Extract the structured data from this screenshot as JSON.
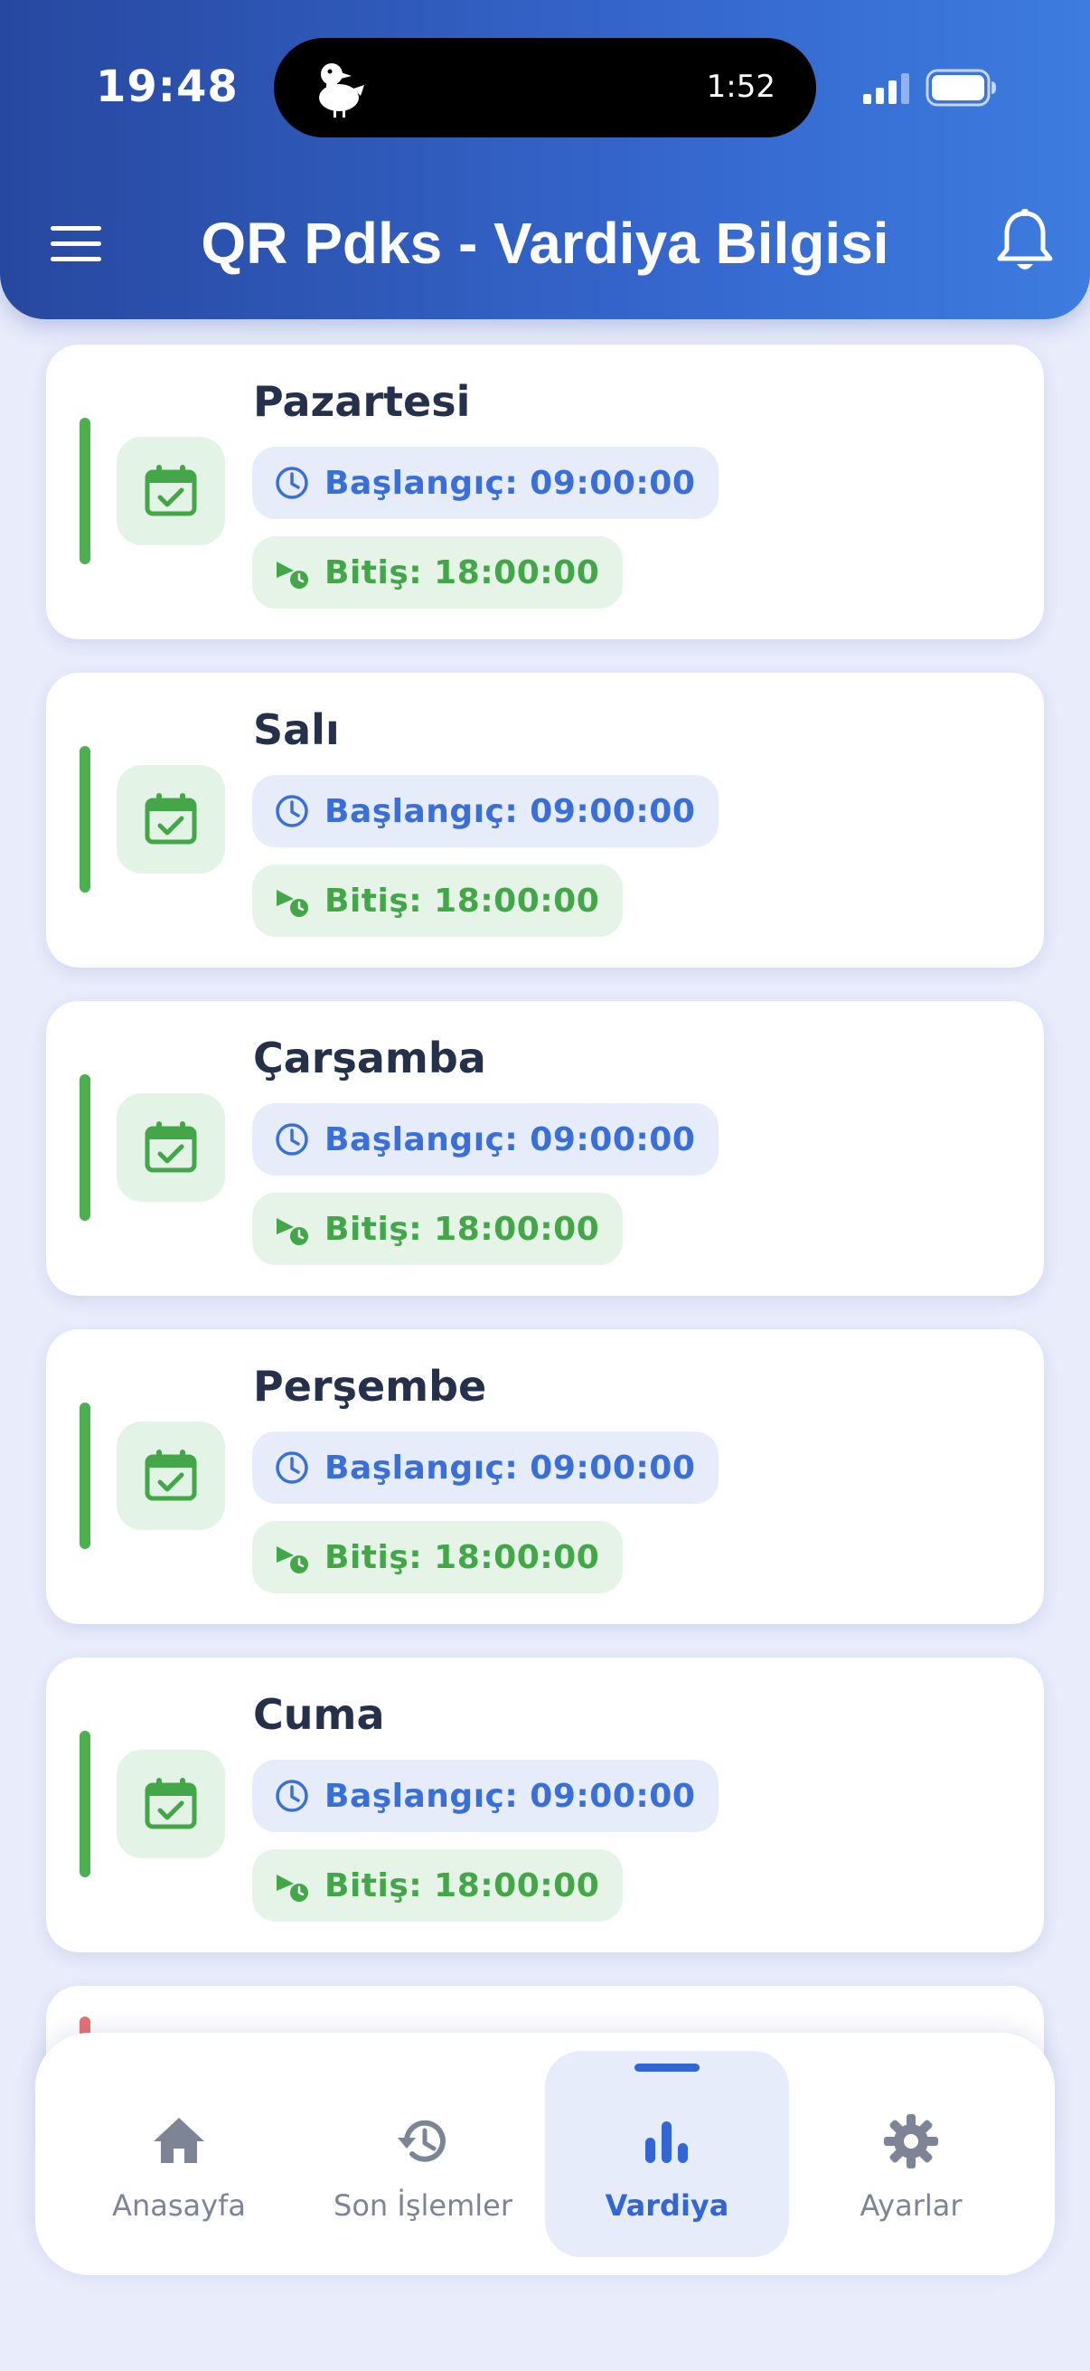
{
  "status_bar": {
    "time": "19:48",
    "island_timer": "1:52"
  },
  "header": {
    "title": "QR Pdks - Vardiya Bilgisi"
  },
  "shifts": [
    {
      "day": "Pazartesi",
      "start": "Başlangıç: 09:00:00",
      "end": "Bitiş: 18:00:00"
    },
    {
      "day": "Salı",
      "start": "Başlangıç: 09:00:00",
      "end": "Bitiş: 18:00:00"
    },
    {
      "day": "Çarşamba",
      "start": "Başlangıç: 09:00:00",
      "end": "Bitiş: 18:00:00"
    },
    {
      "day": "Perşembe",
      "start": "Başlangıç: 09:00:00",
      "end": "Bitiş: 18:00:00"
    },
    {
      "day": "Cuma",
      "start": "Başlangıç: 09:00:00",
      "end": "Bitiş: 18:00:00"
    }
  ],
  "bottom_nav": {
    "items": [
      {
        "label": "Anasayfa",
        "icon": "home-icon"
      },
      {
        "label": "Son İşlemler",
        "icon": "history-icon"
      },
      {
        "label": "Vardiya",
        "icon": "bar-chart-icon",
        "active": true
      },
      {
        "label": "Ayarlar",
        "icon": "gear-icon"
      }
    ]
  },
  "colors": {
    "header_gradient_start": "#2748a0",
    "header_gradient_end": "#3d7ce0",
    "accent_blue": "#3a6fd8",
    "accent_green": "#43a74a",
    "background": "#e8ecfb"
  }
}
